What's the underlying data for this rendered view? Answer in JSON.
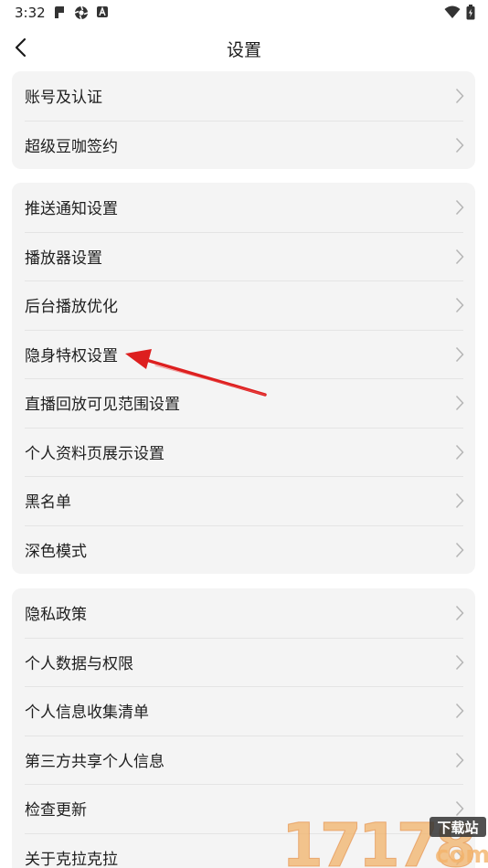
{
  "status_bar": {
    "time": "3:32",
    "left_icons": [
      "notification-app-icon",
      "vpn-icon",
      "a-icon"
    ],
    "right_icons": [
      "wifi-icon",
      "battery-icon"
    ]
  },
  "header": {
    "title": "设置",
    "back_icon": "chevron-left-icon"
  },
  "groups": [
    {
      "items": [
        {
          "label": "账号及认证"
        },
        {
          "label": "超级豆咖签约"
        }
      ]
    },
    {
      "items": [
        {
          "label": "推送通知设置"
        },
        {
          "label": "播放器设置"
        },
        {
          "label": "后台播放优化"
        },
        {
          "label": "隐身特权设置"
        },
        {
          "label": "直播回放可见范围设置"
        },
        {
          "label": "个人资料页展示设置"
        },
        {
          "label": "黑名单"
        },
        {
          "label": "深色模式"
        }
      ]
    },
    {
      "items": [
        {
          "label": "隐私政策"
        },
        {
          "label": "个人数据与权限"
        },
        {
          "label": "个人信息收集清单"
        },
        {
          "label": "第三方共享个人信息"
        },
        {
          "label": "检查更新"
        },
        {
          "label": "关于克拉克拉"
        }
      ]
    }
  ],
  "annotation": {
    "color": "#e02020",
    "target": "隐身特权设置"
  },
  "watermark": {
    "digits": "17178",
    "badge": "下载站",
    "suffix": "com"
  },
  "colors": {
    "group_bg": "#f4f4f4",
    "divider": "#e4e4e4",
    "chevron": "#b5b5b5"
  }
}
